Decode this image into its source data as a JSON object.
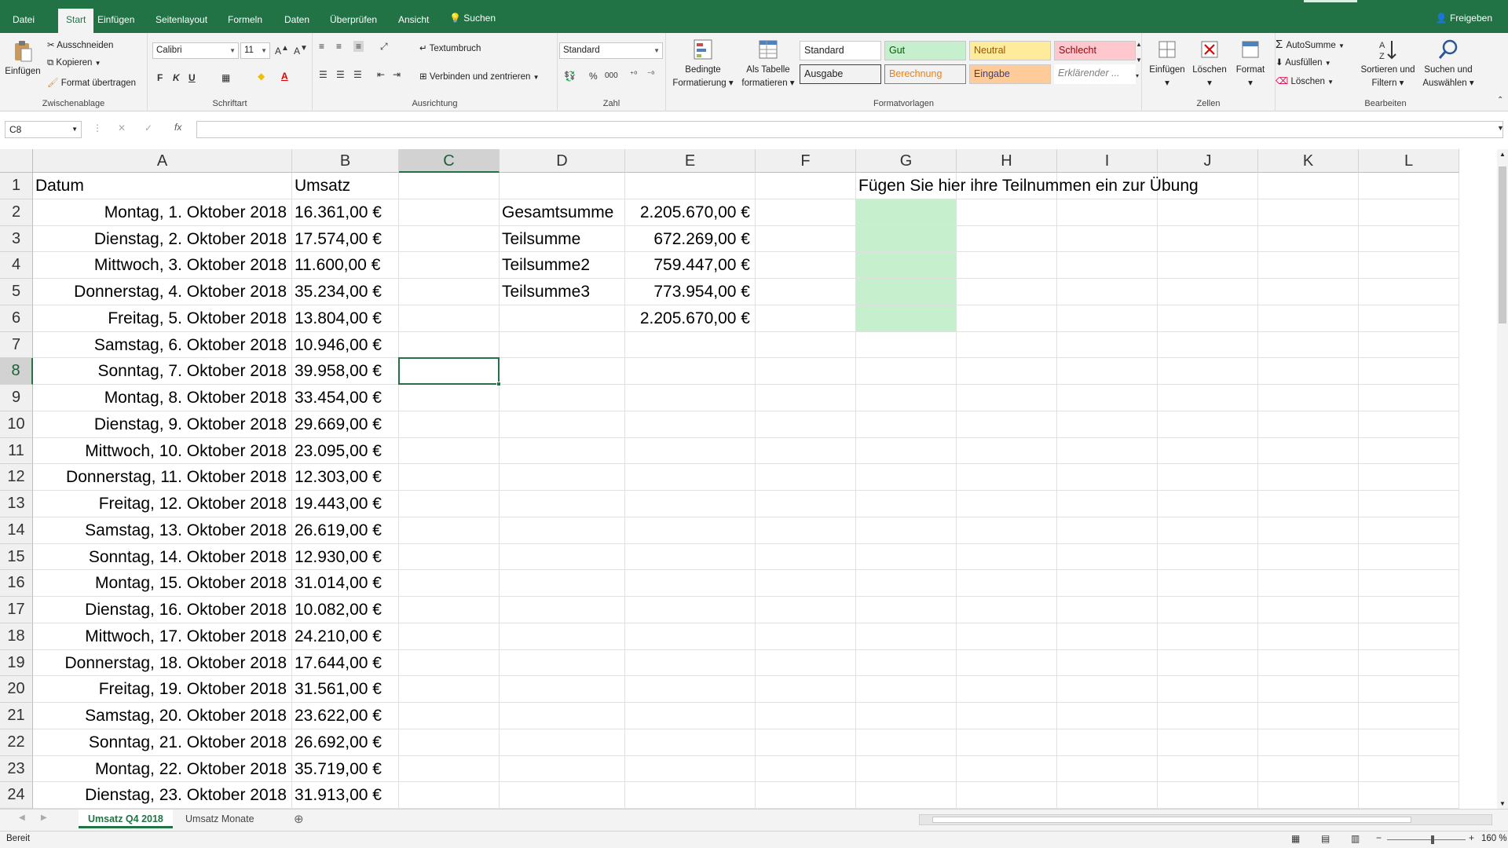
{
  "menu": {
    "tabs": [
      "Datei",
      "Start",
      "Einfügen",
      "Seitenlayout",
      "Formeln",
      "Daten",
      "Überprüfen",
      "Ansicht"
    ],
    "active_tab": "Start",
    "search": "Suchen",
    "share": "Freigeben"
  },
  "ribbon": {
    "clipboard": {
      "paste": "Einfügen",
      "cut": "Ausschneiden",
      "copy": "Kopieren",
      "format_painter": "Format übertragen",
      "label": "Zwischenablage"
    },
    "font": {
      "name": "Calibri",
      "size": "11",
      "bold": "F",
      "italic": "K",
      "underline": "U",
      "label": "Schriftart"
    },
    "alignment": {
      "wrap": "Textumbruch",
      "merge": "Verbinden und zentrieren",
      "label": "Ausrichtung"
    },
    "number": {
      "format": "Standard",
      "percent": "%",
      "thousands": "000",
      "label": "Zahl"
    },
    "cond_format": {
      "line1": "Bedingte",
      "line2": "Formatierung"
    },
    "as_table": {
      "line1": "Als Tabelle",
      "line2": "formatieren"
    },
    "styles": {
      "items": [
        "Standard",
        "Gut",
        "Neutral",
        "Schlecht",
        "Ausgabe",
        "Berechnung",
        "Eingabe",
        "Erklärender ..."
      ],
      "label": "Formatvorlagen"
    },
    "cells": {
      "insert": "Einfügen",
      "delete": "Löschen",
      "format": "Format",
      "label": "Zellen"
    },
    "editing": {
      "autosum": "AutoSumme",
      "fill": "Ausfüllen",
      "clear": "Löschen",
      "sort_line1": "Sortieren und",
      "sort_line2": "Filtern",
      "find_line1": "Suchen und",
      "find_line2": "Auswählen",
      "label": "Bearbeiten"
    }
  },
  "formula_bar": {
    "name_box": "C8",
    "fx": "fx",
    "content": ""
  },
  "columns": [
    "A",
    "B",
    "C",
    "D",
    "E",
    "F",
    "G",
    "H",
    "I",
    "J",
    "K",
    "L"
  ],
  "selected_cell": {
    "column": "C",
    "row": 8
  },
  "rows": [
    {
      "n": "1",
      "A": "Datum",
      "B": "Umsatz",
      "D": "",
      "E": "",
      "G": "Fügen Sie hier ihre Teilnummen ein zur Übung"
    },
    {
      "n": "2",
      "A": "Montag, 1. Oktober 2018",
      "B": "16.361,00 €",
      "D": "Gesamtsumme",
      "E": "2.205.670,00 €",
      "G": ""
    },
    {
      "n": "3",
      "A": "Dienstag, 2. Oktober 2018",
      "B": "17.574,00 €",
      "D": "Teilsumme",
      "E": "672.269,00 €",
      "G": ""
    },
    {
      "n": "4",
      "A": "Mittwoch, 3. Oktober 2018",
      "B": "11.600,00 €",
      "D": "Teilsumme2",
      "E": "759.447,00 €",
      "G": ""
    },
    {
      "n": "5",
      "A": "Donnerstag, 4. Oktober 2018",
      "B": "35.234,00 €",
      "D": "Teilsumme3",
      "E": "773.954,00 €",
      "G": ""
    },
    {
      "n": "6",
      "A": "Freitag, 5. Oktober 2018",
      "B": "13.804,00 €",
      "D": "",
      "E": "2.205.670,00 €",
      "G": ""
    },
    {
      "n": "7",
      "A": "Samstag, 6. Oktober 2018",
      "B": "10.946,00 €",
      "D": "",
      "E": "",
      "G": ""
    },
    {
      "n": "8",
      "A": "Sonntag, 7. Oktober 2018",
      "B": "39.958,00 €",
      "D": "",
      "E": "",
      "G": ""
    },
    {
      "n": "9",
      "A": "Montag, 8. Oktober 2018",
      "B": "33.454,00 €",
      "D": "",
      "E": "",
      "G": ""
    },
    {
      "n": "10",
      "A": "Dienstag, 9. Oktober 2018",
      "B": "29.669,00 €",
      "D": "",
      "E": "",
      "G": ""
    },
    {
      "n": "11",
      "A": "Mittwoch, 10. Oktober 2018",
      "B": "23.095,00 €",
      "D": "",
      "E": "",
      "G": ""
    },
    {
      "n": "12",
      "A": "Donnerstag, 11. Oktober 2018",
      "B": "12.303,00 €",
      "D": "",
      "E": "",
      "G": ""
    },
    {
      "n": "13",
      "A": "Freitag, 12. Oktober 2018",
      "B": "19.443,00 €",
      "D": "",
      "E": "",
      "G": ""
    },
    {
      "n": "14",
      "A": "Samstag, 13. Oktober 2018",
      "B": "26.619,00 €",
      "D": "",
      "E": "",
      "G": ""
    },
    {
      "n": "15",
      "A": "Sonntag, 14. Oktober 2018",
      "B": "12.930,00 €",
      "D": "",
      "E": "",
      "G": ""
    },
    {
      "n": "16",
      "A": "Montag, 15. Oktober 2018",
      "B": "31.014,00 €",
      "D": "",
      "E": "",
      "G": ""
    },
    {
      "n": "17",
      "A": "Dienstag, 16. Oktober 2018",
      "B": "10.082,00 €",
      "D": "",
      "E": "",
      "G": ""
    },
    {
      "n": "18",
      "A": "Mittwoch, 17. Oktober 2018",
      "B": "24.210,00 €",
      "D": "",
      "E": "",
      "G": ""
    },
    {
      "n": "19",
      "A": "Donnerstag, 18. Oktober 2018",
      "B": "17.644,00 €",
      "D": "",
      "E": "",
      "G": ""
    },
    {
      "n": "20",
      "A": "Freitag, 19. Oktober 2018",
      "B": "31.561,00 €",
      "D": "",
      "E": "",
      "G": ""
    },
    {
      "n": "21",
      "A": "Samstag, 20. Oktober 2018",
      "B": "23.622,00 €",
      "D": "",
      "E": "",
      "G": ""
    },
    {
      "n": "22",
      "A": "Sonntag, 21. Oktober 2018",
      "B": "26.692,00 €",
      "D": "",
      "E": "",
      "G": ""
    },
    {
      "n": "23",
      "A": "Montag, 22. Oktober 2018",
      "B": "35.719,00 €",
      "D": "",
      "E": "",
      "G": ""
    },
    {
      "n": "24",
      "A": "Dienstag, 23. Oktober 2018",
      "B": "31.913,00 €",
      "D": "",
      "E": "",
      "G": ""
    }
  ],
  "sheets": [
    "Umsatz Q4 2018",
    "Umsatz Monate"
  ],
  "active_sheet": "Umsatz Q4 2018",
  "status": {
    "mode": "Bereit",
    "zoom": "160 %"
  },
  "colors": {
    "accent": "#217346",
    "highlight_fill": "#c6efce",
    "selection_border": "#217346"
  }
}
